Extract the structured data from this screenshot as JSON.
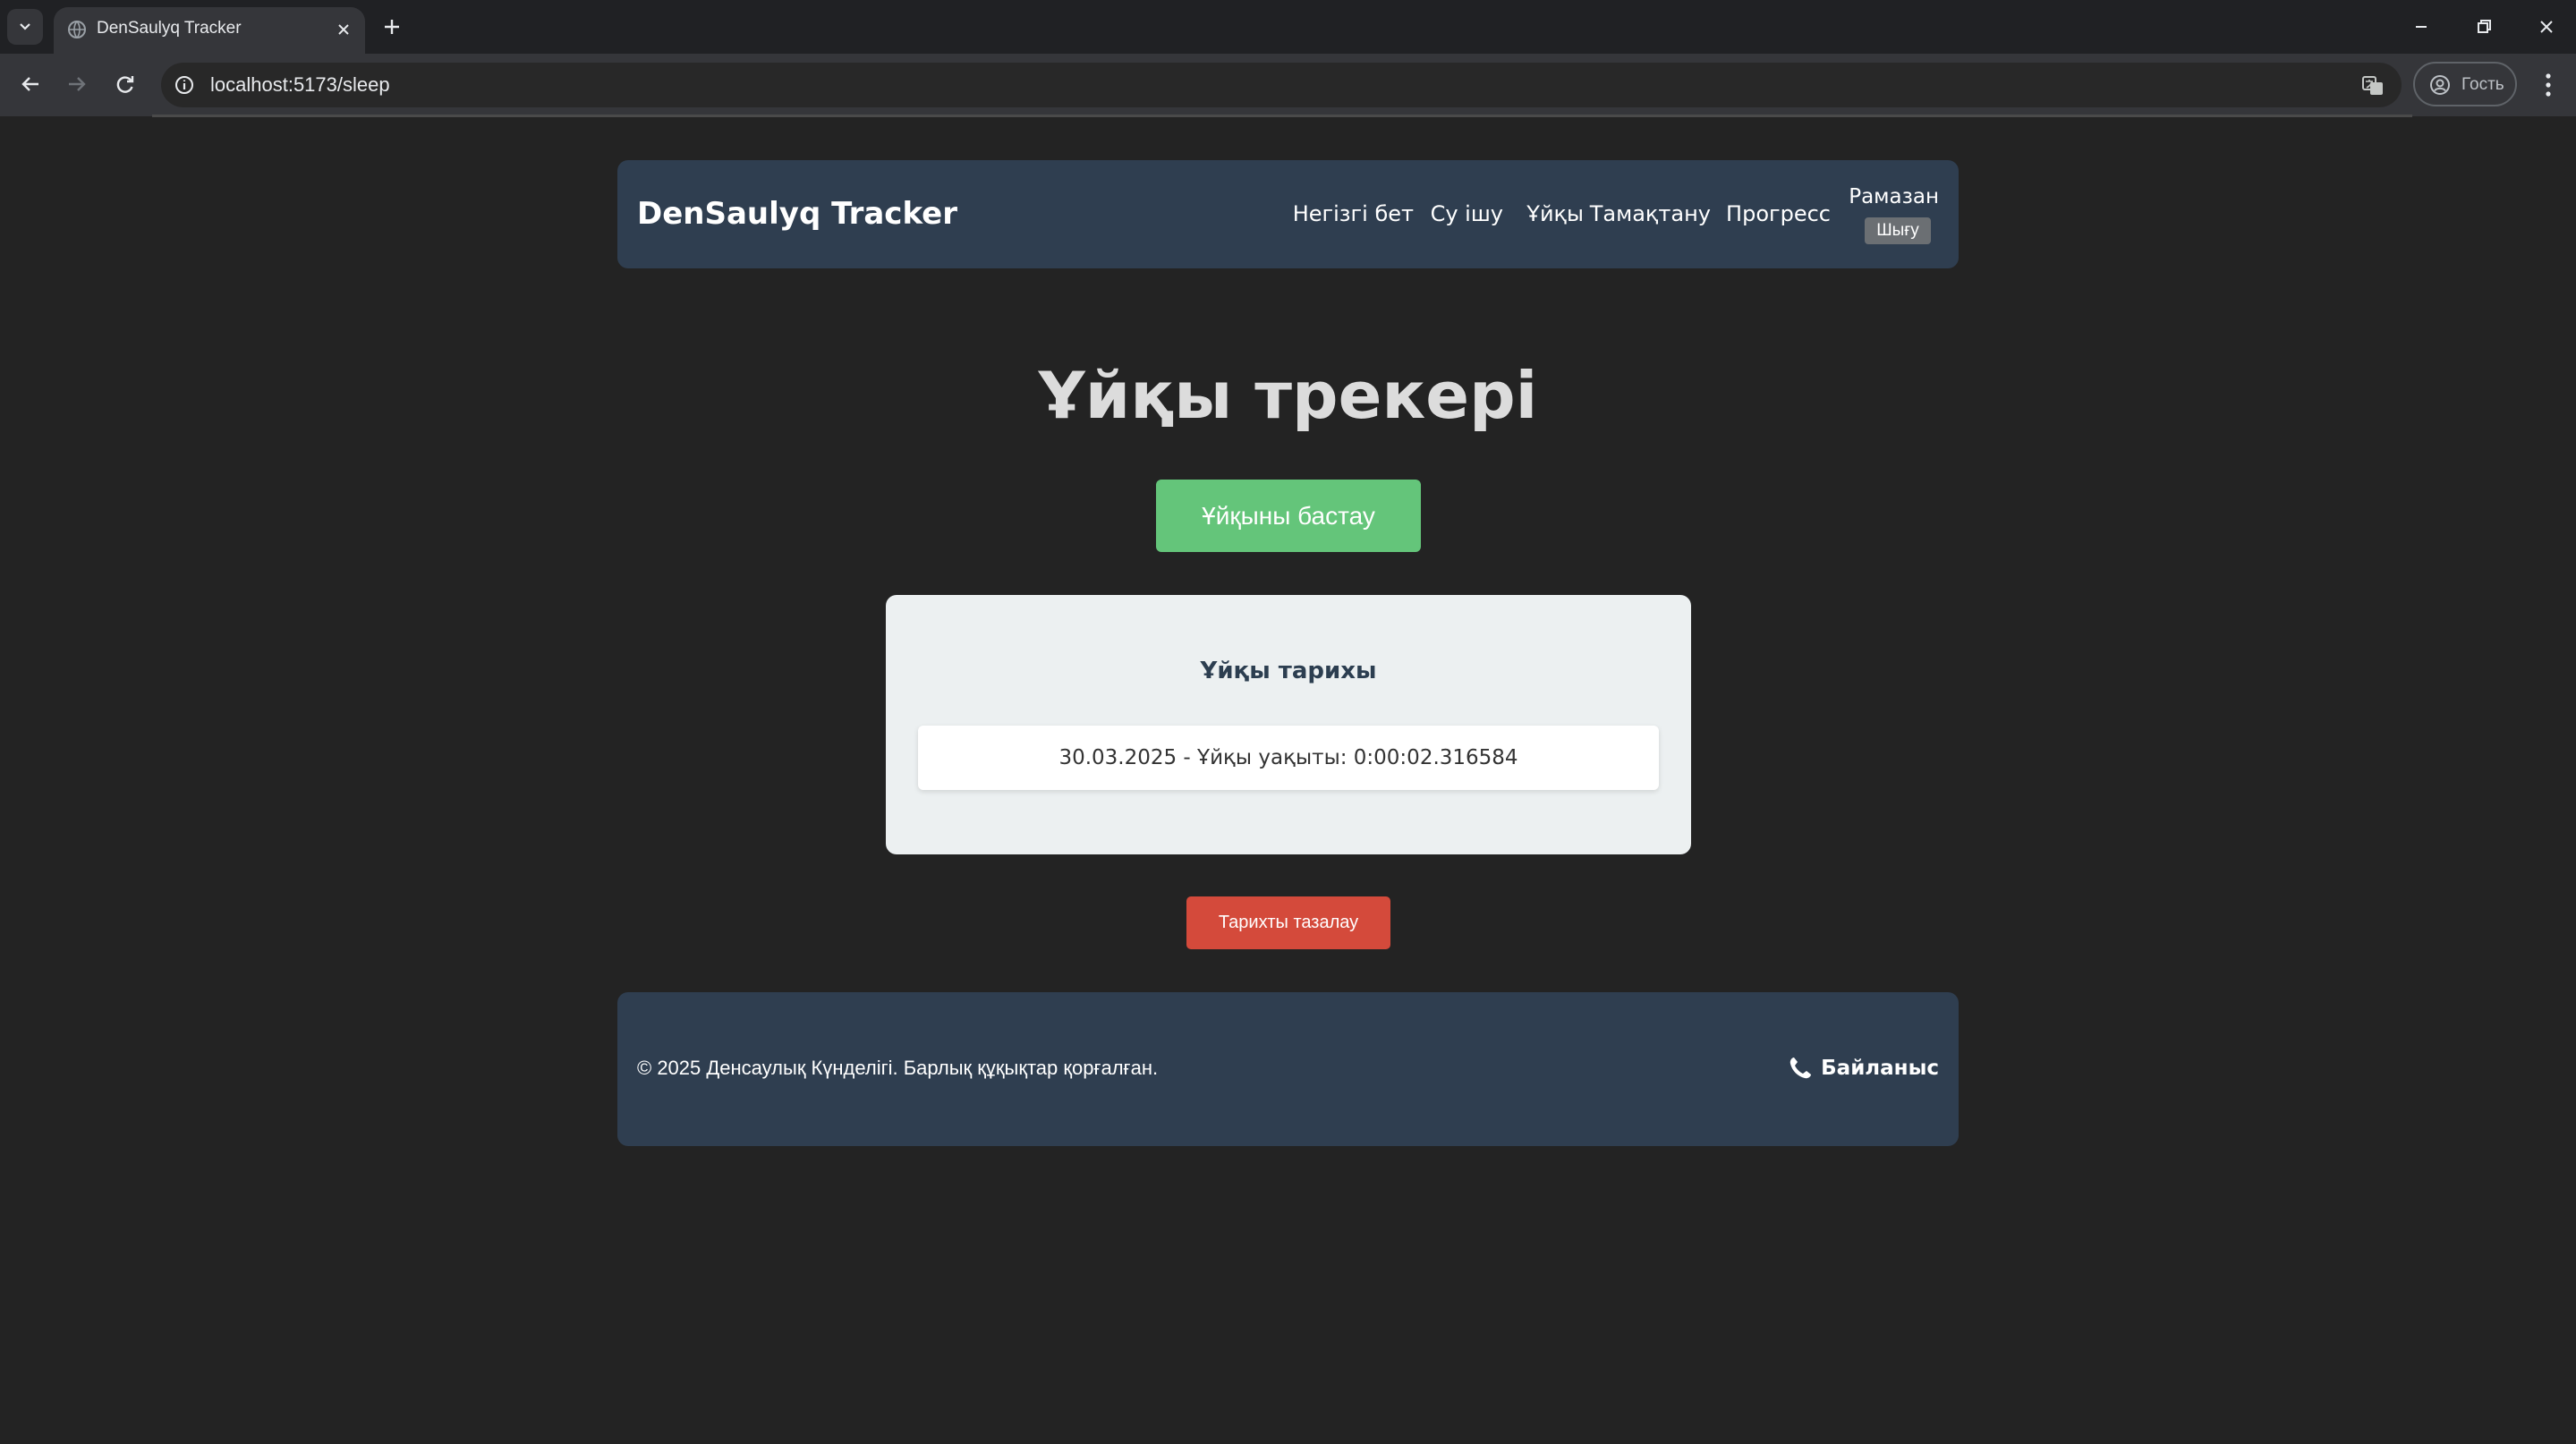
{
  "browser": {
    "tab_title": "DenSaulyq Tracker",
    "url": "localhost:5173/sleep",
    "profile_label": "Гость"
  },
  "header": {
    "brand": "DenSaulyq Tracker",
    "nav": [
      "Негізгі бет",
      "Су ішу",
      "Ұйқы",
      "Тамақтану",
      "Прогресс"
    ],
    "username": "Рамазан",
    "logout": "Шығу"
  },
  "main": {
    "title": "Ұйқы трекері",
    "start_button": "Ұйқыны бастау",
    "history": {
      "title": "Ұйқы тарихы",
      "items": [
        "30.03.2025 - Ұйқы уақыты: 0:00:02.316584"
      ]
    },
    "clear_button": "Тарихты тазалау"
  },
  "footer": {
    "copyright": "© 2025 Денсаулық Күнделігі. Барлық құқықтар қорғалған.",
    "contact": "Байланыс"
  },
  "colors": {
    "background": "#232323",
    "panel": "#2f3e50",
    "start_button": "#64c57a",
    "clear_button": "#d44a3b",
    "card": "#ecf0f1"
  }
}
